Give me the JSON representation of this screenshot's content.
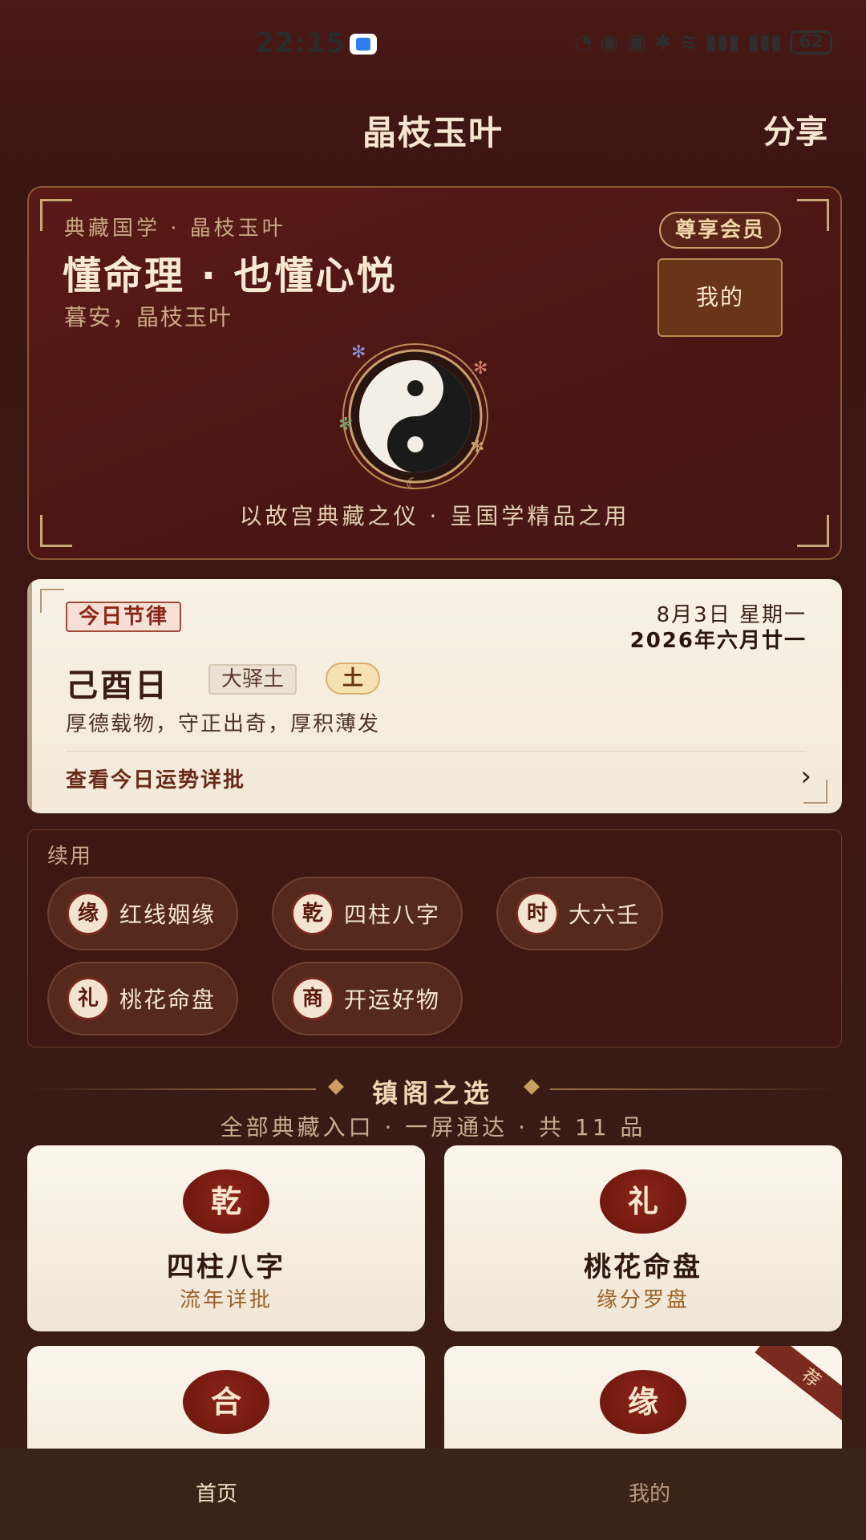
{
  "status_bar": {
    "time": "22:15",
    "battery": "62"
  },
  "header": {
    "title": "晶枝玉叶",
    "share_label": "分享"
  },
  "hero": {
    "kicker": "典藏国学 · 晶枝玉叶",
    "title": "懂命理 · 也懂心悦",
    "greeting": "暮安，晶枝玉叶",
    "vip_badge": "尊享会员",
    "mine_button": "我的",
    "motto": "以故宫典藏之仪 · 呈国学精品之用"
  },
  "today": {
    "tag": "今日节律",
    "date_solar": "8月3日 星期一",
    "date_lunar": "2026年六月廿一",
    "day_name": "己酉日",
    "nayin": "大驿土",
    "element": "土",
    "motto": "厚德载物，守正出奇，厚积薄发",
    "detail_link": "查看今日运势详批",
    "arrow": "›"
  },
  "continue_use": {
    "label": "续用",
    "items": [
      {
        "icon": "缘",
        "label": "红线姻缘"
      },
      {
        "icon": "乾",
        "label": "四柱八字"
      },
      {
        "icon": "时",
        "label": "大六壬"
      },
      {
        "icon": "礼",
        "label": "桃花命盘"
      },
      {
        "icon": "商",
        "label": "开运好物"
      }
    ]
  },
  "selection": {
    "title": "镇阁之选",
    "subtitle": "全部典藏入口 · 一屏通达 · 共 11 品",
    "cards": [
      {
        "icon": "乾",
        "title": "四柱八字",
        "subtitle": "流年详批"
      },
      {
        "icon": "礼",
        "title": "桃花命盘",
        "subtitle": "缘分罗盘"
      },
      {
        "icon": "合",
        "title": "",
        "subtitle": ""
      },
      {
        "icon": "缘",
        "title": "",
        "subtitle": "",
        "ribbon": "荐"
      }
    ]
  },
  "bottom_nav": {
    "home": "首页",
    "mine": "我的"
  },
  "colors": {
    "background": "#3b1512",
    "accent_gold": "#c9a070",
    "seal_red": "#7a1a10",
    "card_cream": "#f8f1e6"
  }
}
